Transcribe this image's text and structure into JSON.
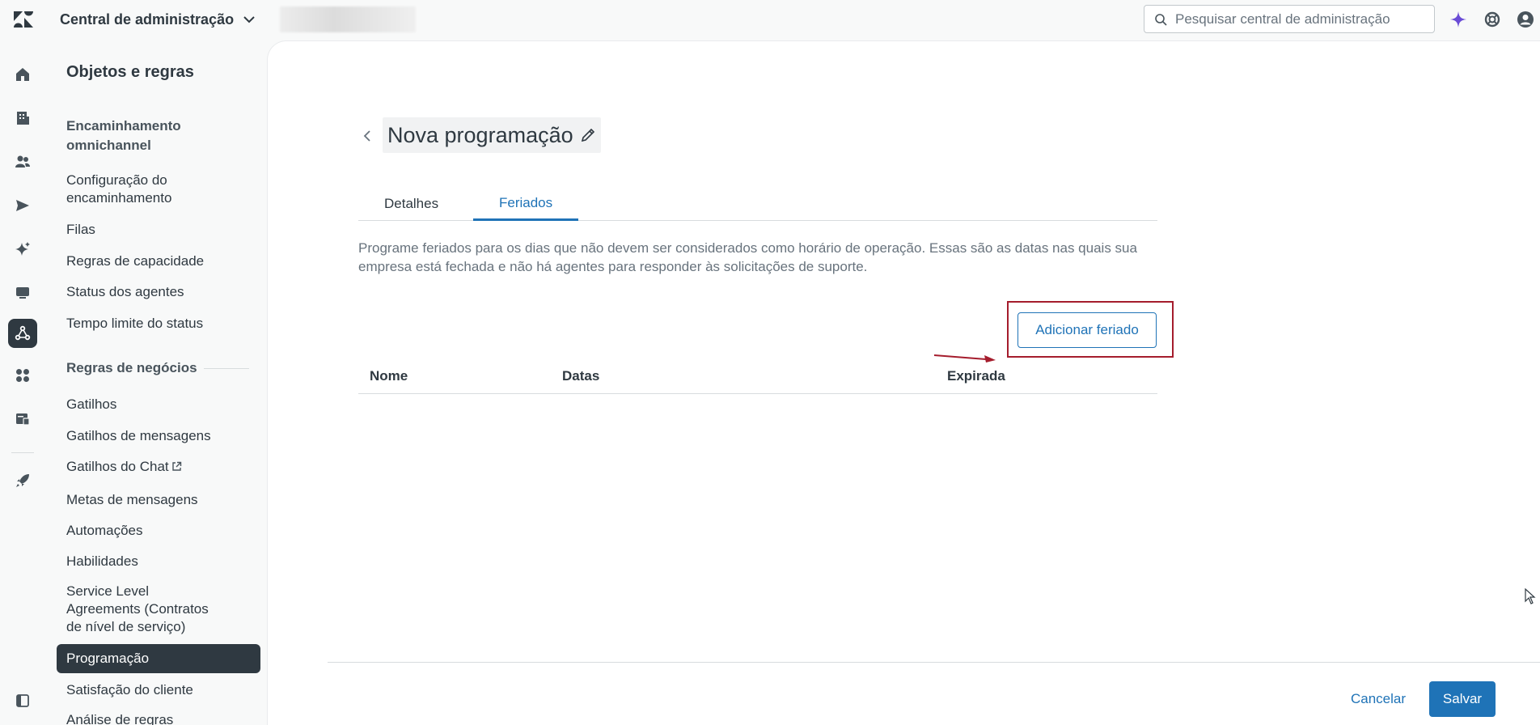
{
  "topbar": {
    "product_name": "Central de administração",
    "search_placeholder": "Pesquisar central de administração"
  },
  "nav": {
    "title": "Objetos e regras",
    "sections": [
      {
        "label": "Encaminhamento omnichannel",
        "items": [
          "Configuração do encaminhamento",
          "Filas",
          "Regras de capacidade",
          "Status dos agentes",
          "Tempo limite do status"
        ]
      },
      {
        "label": "Regras de negócios",
        "items": [
          "Gatilhos",
          "Gatilhos de mensagens",
          "Gatilhos do Chat",
          "Metas de mensagens",
          "Automações",
          "Habilidades",
          "Service Level Agreements (Contratos de nível de serviço)",
          "Programação",
          "Satisfação do cliente",
          "Análise de regras"
        ]
      }
    ],
    "active_item": "Programação"
  },
  "page": {
    "title": "Nova programação",
    "tabs": [
      {
        "label": "Detalhes",
        "active": false
      },
      {
        "label": "Feriados",
        "active": true
      }
    ],
    "description": "Programe feriados para os dias que não devem ser considerados como horário de operação. Essas são as datas nas quais sua empresa está fechada e não há agentes para responder às solicitações de suporte.",
    "add_button": "Adicionar feriado",
    "table": {
      "columns": [
        "Nome",
        "Datas",
        "Expirada"
      ],
      "rows": []
    },
    "cancel_button": "Cancelar",
    "save_button": "Salvar"
  },
  "colors": {
    "accent": "#1f73b7",
    "active_nav_bg": "#2f3941",
    "highlight_box": "#a51d2d",
    "ai_sparkle": "#6a4cd6"
  },
  "icons": {
    "rail": [
      "home-icon",
      "building-icon",
      "people-icon",
      "send-icon",
      "sparkle-icon",
      "chat-icon",
      "objects-rules-icon",
      "apps-icon",
      "workspace-icon",
      "rocket-icon",
      "collapse-panel-icon"
    ],
    "topbar": [
      "zendesk-logo",
      "chevron-down-icon",
      "search-icon",
      "ai-sparkle-icon",
      "help-icon",
      "user-avatar-icon"
    ]
  }
}
